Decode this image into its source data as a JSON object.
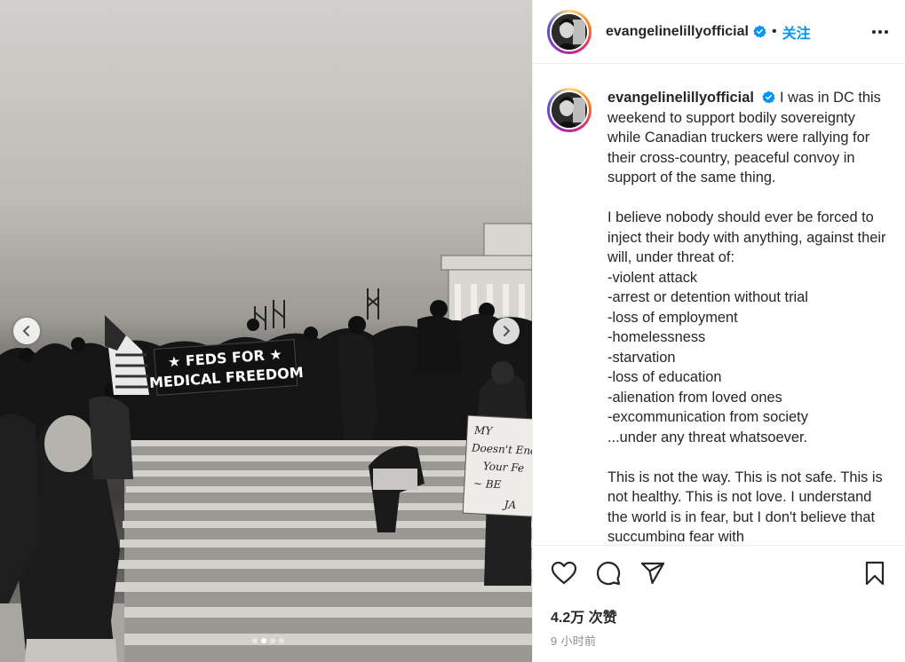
{
  "post": {
    "username": "evangelinelillyofficial",
    "follow_separator": "•",
    "follow_label": "关注",
    "caption": "I was in DC this weekend to support bodily sovereignty while Canadian truckers were rallying for their cross-country, peaceful convoy in support of the same thing.\n\nI believe nobody should ever be forced to inject their body with anything, against their will, under threat of:\n-violent attack\n-arrest or detention without trial\n-loss of employment\n-homelessness\n-starvation\n-loss of education\n-alienation from loved ones\n-excommunication from society\n...under any threat whatsoever.\n\nThis is not the way. This is not safe. This is not healthy. This is not love. I understand the world is in fear, but I don't believe that succumbing fear with",
    "likes": "4.2万 次赞",
    "time_ago": "9 小时前"
  },
  "photo": {
    "banner_line1": "★ FEDS FOR ★",
    "banner_line2": "MEDICAL FREEDOM",
    "sign_lines": [
      "MY",
      "Doesn't End",
      "Your Fe",
      "~ BE",
      "JA"
    ],
    "carousel_count": 4,
    "carousel_active": 2
  },
  "icons": {
    "verified": "verified-badge-icon",
    "more": "more-options-icon",
    "like": "heart-icon",
    "comment": "comment-icon",
    "share": "paper-plane-icon",
    "save": "bookmark-icon",
    "prev": "chevron-left-icon",
    "next": "chevron-right-icon"
  },
  "colors": {
    "accent": "#0095f6",
    "text": "#262626",
    "muted": "#8e8e8e",
    "border": "#efefef"
  }
}
